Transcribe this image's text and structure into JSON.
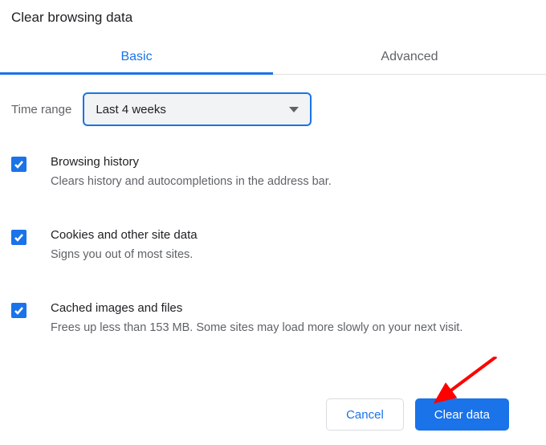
{
  "title": "Clear browsing data",
  "tabs": {
    "basic": "Basic",
    "advanced": "Advanced"
  },
  "range": {
    "label": "Time range",
    "value": "Last 4 weeks"
  },
  "options": [
    {
      "title": "Browsing history",
      "desc": "Clears history and autocompletions in the address bar.",
      "checked": true
    },
    {
      "title": "Cookies and other site data",
      "desc": "Signs you out of most sites.",
      "checked": true
    },
    {
      "title": "Cached images and files",
      "desc": "Frees up less than 153 MB. Some sites may load more slowly on your next visit.",
      "checked": true
    }
  ],
  "buttons": {
    "cancel": "Cancel",
    "clear": "Clear data"
  }
}
